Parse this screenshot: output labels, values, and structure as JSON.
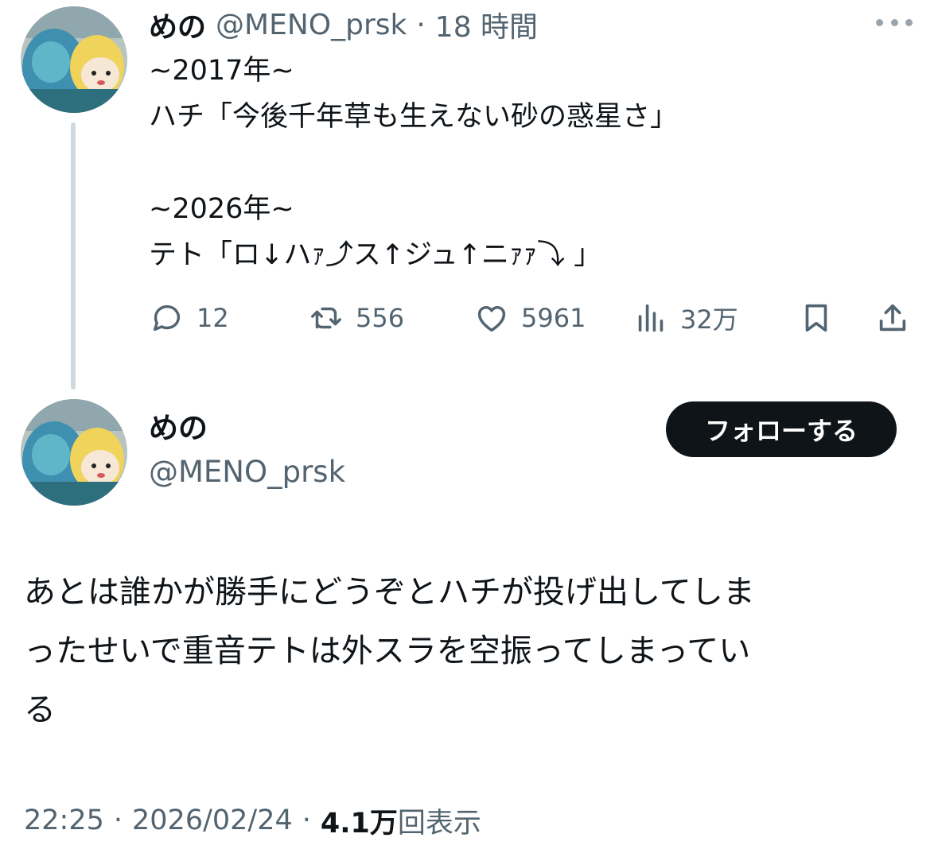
{
  "tweet": {
    "author_name": "めの",
    "handle": "@MENO_prsk",
    "separator": "·",
    "time": "18 時間",
    "more_icon": "more-horizontal-icon",
    "lines": [
      "~2017年~",
      "ハチ「今後千年草も生えない砂の惑星さ」",
      "",
      "~2026年~",
      "テト「ロ↓ハｧ⤴ス↑ジュ↑ニｧｧ⤵ 」"
    ],
    "actions": {
      "reply": {
        "icon": "reply-icon",
        "count": "12"
      },
      "retweet": {
        "icon": "retweet-icon",
        "count": "556"
      },
      "like": {
        "icon": "heart-icon",
        "count": "5961"
      },
      "views": {
        "icon": "bar-chart-icon",
        "count": "32万"
      },
      "bookmark": {
        "icon": "bookmark-icon"
      },
      "share": {
        "icon": "share-icon"
      }
    }
  },
  "profile": {
    "name": "めの",
    "handle": "@MENO_prsk",
    "follow_label": "フォローする"
  },
  "main_post": {
    "lines": [
      "あとは誰かが勝手にどうぞとハチが投げ出してしま",
      "ったせいで重音テトは外スラを空振ってしまってい",
      "る"
    ],
    "time": "22:25",
    "separator1": "·",
    "date": "2026/02/24",
    "separator2": "·",
    "views_count": "4.1万",
    "views_label": "回表示"
  },
  "colors": {
    "text": "#0f1419",
    "muted": "#536471",
    "thread_line": "#cfd9de",
    "follow_bg": "#0f1419"
  }
}
